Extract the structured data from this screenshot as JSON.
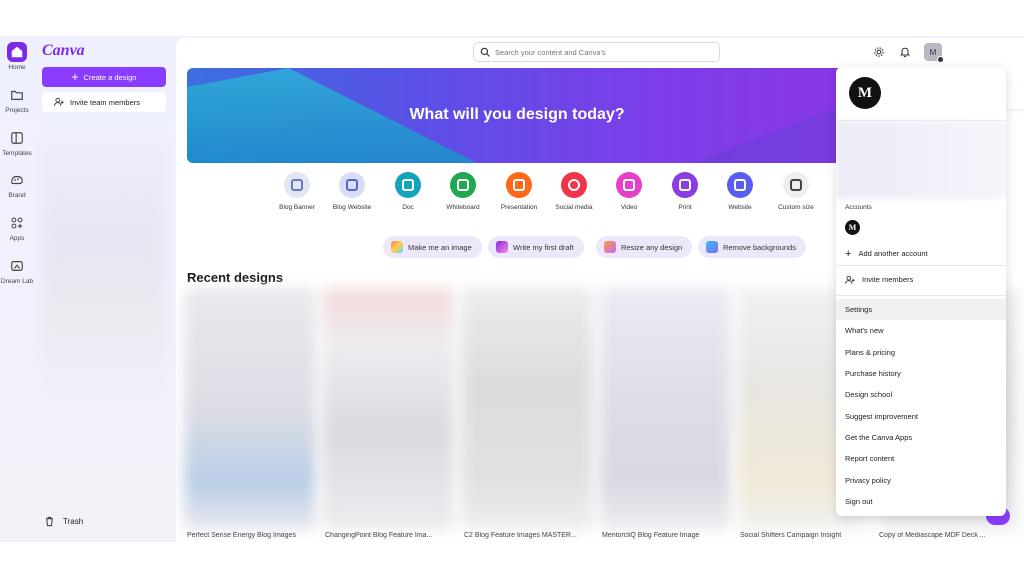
{
  "brand": {
    "logo_text": "Canva",
    "accent": "#8b3dff"
  },
  "rail": [
    {
      "label": "Home",
      "icon": "home-icon"
    },
    {
      "label": "Projects",
      "icon": "folder-icon"
    },
    {
      "label": "Templates",
      "icon": "templates-icon"
    },
    {
      "label": "Brand",
      "icon": "brand-icon"
    },
    {
      "label": "Apps",
      "icon": "apps-icon"
    },
    {
      "label": "Dream Lab",
      "icon": "dream-lab-icon"
    }
  ],
  "sidepanel": {
    "create_label": "Create a design",
    "invite_label": "Invite team members",
    "trash_label": "Trash"
  },
  "header": {
    "search_placeholder": "Search your content and Canva's",
    "avatar_initial": "M"
  },
  "banner": {
    "title": "What will you design today?"
  },
  "design_types": [
    {
      "label": "Blog Banner",
      "color": "#e3e7f3"
    },
    {
      "label": "Blog Website",
      "color": "#d9ddf7"
    },
    {
      "label": "Doc",
      "color": "#14a3b8"
    },
    {
      "label": "Whiteboard",
      "color": "#1fa84f"
    },
    {
      "label": "Presentation",
      "color": "#ff6a1a"
    },
    {
      "label": "Social media",
      "color": "#f2344a"
    },
    {
      "label": "Video",
      "color": "#e640c9"
    },
    {
      "label": "Print",
      "color": "#8a3de0"
    },
    {
      "label": "Website",
      "color": "#5a5ef0"
    },
    {
      "label": "Custom size",
      "color": "#eeeef2"
    }
  ],
  "ai_chips": [
    {
      "label": "Make me an image"
    },
    {
      "label": "Write my first draft"
    },
    {
      "label": "Resize any design"
    },
    {
      "label": "Remove backgrounds"
    }
  ],
  "recent": {
    "title": "Recent designs",
    "items": [
      {
        "label": "Perfect Sense Energy Blog Images"
      },
      {
        "label": "ChangingPoint Blog Feature Ima..."
      },
      {
        "label": "C2 Blog Feature Images MASTER..."
      },
      {
        "label": "MentorcliQ Blog Feature Image"
      },
      {
        "label": "Social Shifters Campaign Insight"
      },
      {
        "label": "Copy of Mediascape MDF Deck ..."
      }
    ]
  },
  "account_menu": {
    "avatar_letter": "M",
    "accounts_label": "Accounts",
    "add_account": "Add another account",
    "invite_members": "Invite members",
    "items": [
      {
        "label": "Settings"
      },
      {
        "label": "What's new"
      },
      {
        "label": "Plans & pricing"
      },
      {
        "label": "Purchase history"
      },
      {
        "label": "Design school"
      },
      {
        "label": "Suggest improvement"
      },
      {
        "label": "Get the Canva Apps"
      },
      {
        "label": "Report content"
      },
      {
        "label": "Privacy policy"
      },
      {
        "label": "Sign out"
      }
    ]
  }
}
